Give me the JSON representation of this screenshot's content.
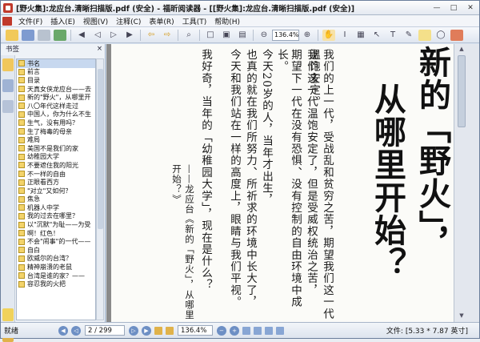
{
  "window": {
    "title": "[野火集]:龙应台.清晰扫描版.pdf (安全) - 福昕阅读器 - [[野火集]:龙应台.清晰扫描版.pdf (安全)]"
  },
  "menu": {
    "items": [
      "文件(F)",
      "插入(E)",
      "视图(V)",
      "注释(C)",
      "表单(R)",
      "工具(T)",
      "帮助(H)"
    ]
  },
  "toolbar": {
    "zoom_value": "136.4%"
  },
  "bookmarks": {
    "header": "书签",
    "close_glyph": "×",
    "items": [
      "书名",
      "前言",
      "目录",
      "天真女侠龙应台——去",
      "新的\"野火\"，从哪里开",
      "八〇年代这样走过",
      "中国人，你为什么不生",
      "生气，没有用吗？",
      "生了梅毒的母亲",
      "难局",
      "美国不是我们的家",
      "幼稚园大学",
      "不要遮住我的阳光",
      "不一样的自由",
      "正眼看西方",
      "\"对立\"又如何？",
      "焦急",
      "机器人中学",
      "我的过去在哪里？",
      "以\"沉默\"为耻——为受",
      "啊！红色！",
      "不会\"闹事\"的一代——",
      "自白",
      "欧威尔的台湾？",
      "精神崩溃的老鼠",
      "台湾是谁的家？——",
      "容忍我的火把"
    ]
  },
  "document": {
    "title_lines": [
      "新的「野火」，",
      "从哪里开始？"
    ],
    "columns": [
      "我们的上一代，受战乱和贫穷之苦，期望我们这一代温饱安定。",
      "我们这一代温饱安定了，但是受威权统治之苦，",
      "期望下一代在没有恐惧、没有控制的自由环境中成长。",
      "",
      "今天20岁的人，当年才出生，",
      "也真的就在我们所努力、所祈求的环境中长大了，",
      "今天和我们站在一样的高度上，眼睛与我们平视。",
      "",
      "我好奇，当年的「幼稚园大学」，现在是什么？"
    ],
    "signature": "——龙应台《新的「野火」，从哪里开始？》"
  },
  "statusbar": {
    "left_label": "就绪",
    "page_value": "2 / 299",
    "zoom_value": "136.4%",
    "doc_size": "文件: [5.33 * 7.87 英寸]"
  }
}
